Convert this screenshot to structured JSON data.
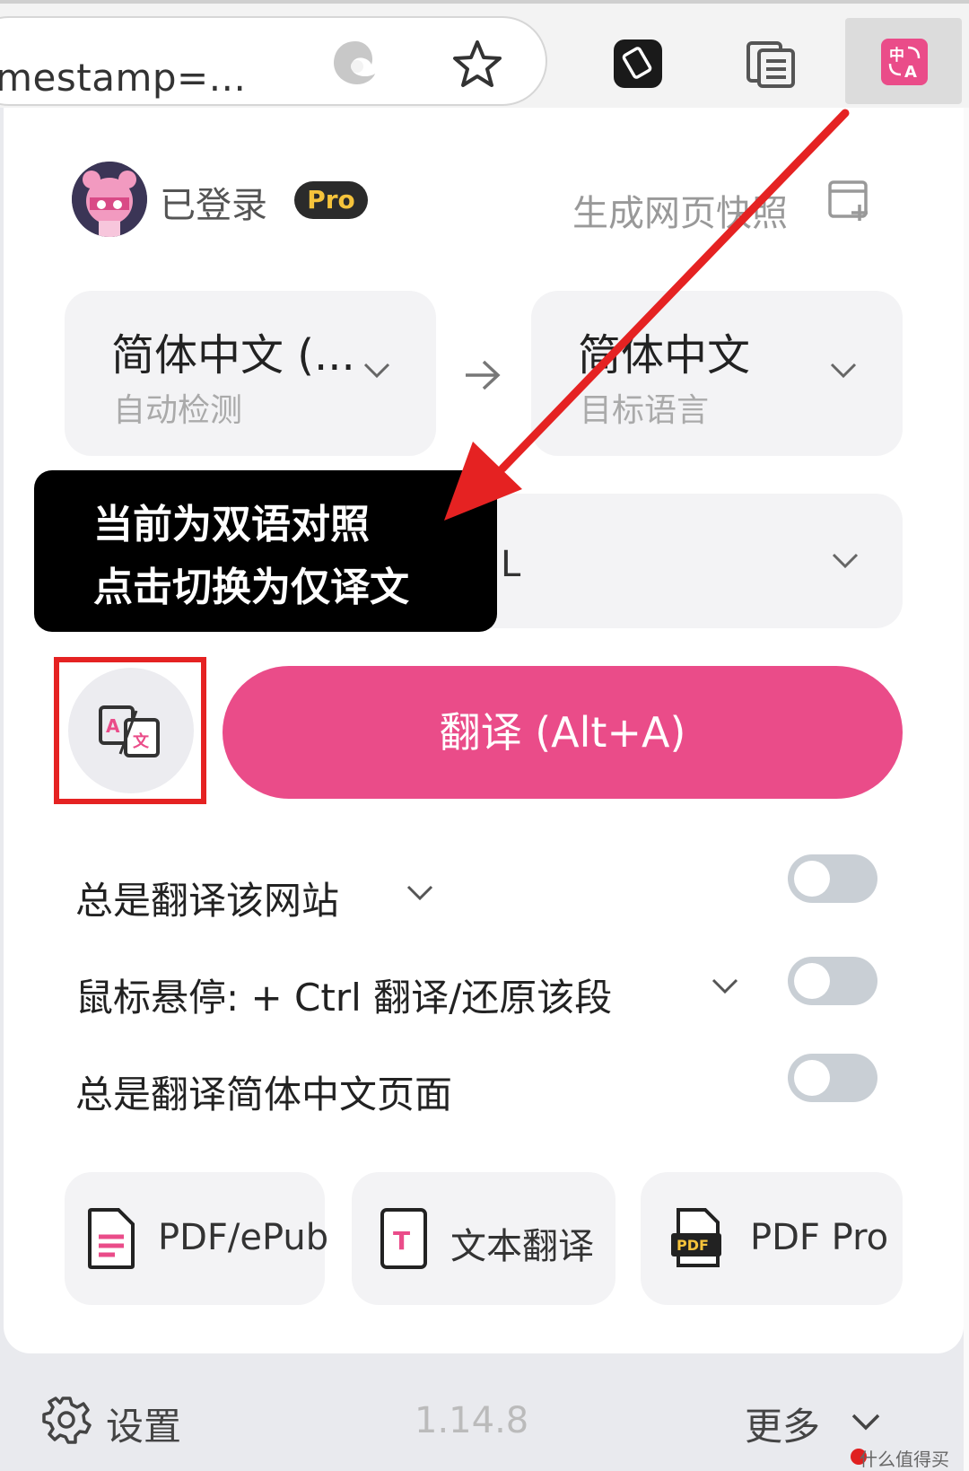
{
  "browser": {
    "url_text": "timestamp=...",
    "translate_ext_label": "中\nA"
  },
  "header": {
    "login_status": "已登录",
    "pro_badge": "Pro",
    "snapshot_label": "生成网页快照"
  },
  "languages": {
    "source": {
      "name": "简体中文 (...",
      "sub": "自动检测"
    },
    "target": {
      "name": "简体中文",
      "sub": "目标语言"
    }
  },
  "service": {
    "partial_text": "L"
  },
  "tooltip": {
    "line1": "当前为双语对照",
    "line2": "点击切换为仅译文"
  },
  "translate_button": {
    "label": "翻译 (Alt+A)"
  },
  "options": [
    {
      "label": "总是翻译该网站",
      "enabled": false
    },
    {
      "label": "鼠标悬停:  + Ctrl 翻译/还原该段",
      "enabled": false
    },
    {
      "label": "总是翻译简体中文页面",
      "enabled": false
    }
  ],
  "tools": [
    {
      "label": "PDF/ePub",
      "icon": "pdf-file-icon"
    },
    {
      "label": "文本翻译",
      "icon": "text-translate-icon"
    },
    {
      "label": "PDF Pro",
      "icon": "pdf-pro-icon"
    }
  ],
  "footer": {
    "settings_label": "设置",
    "version": "1.14.8",
    "more_label": "更多"
  },
  "watermark": "什么值得买",
  "colors": {
    "accent": "#ea4c89",
    "highlight": "#e52222",
    "toggle_off": "#c9cfd5",
    "tooltip_bg": "#000000"
  }
}
